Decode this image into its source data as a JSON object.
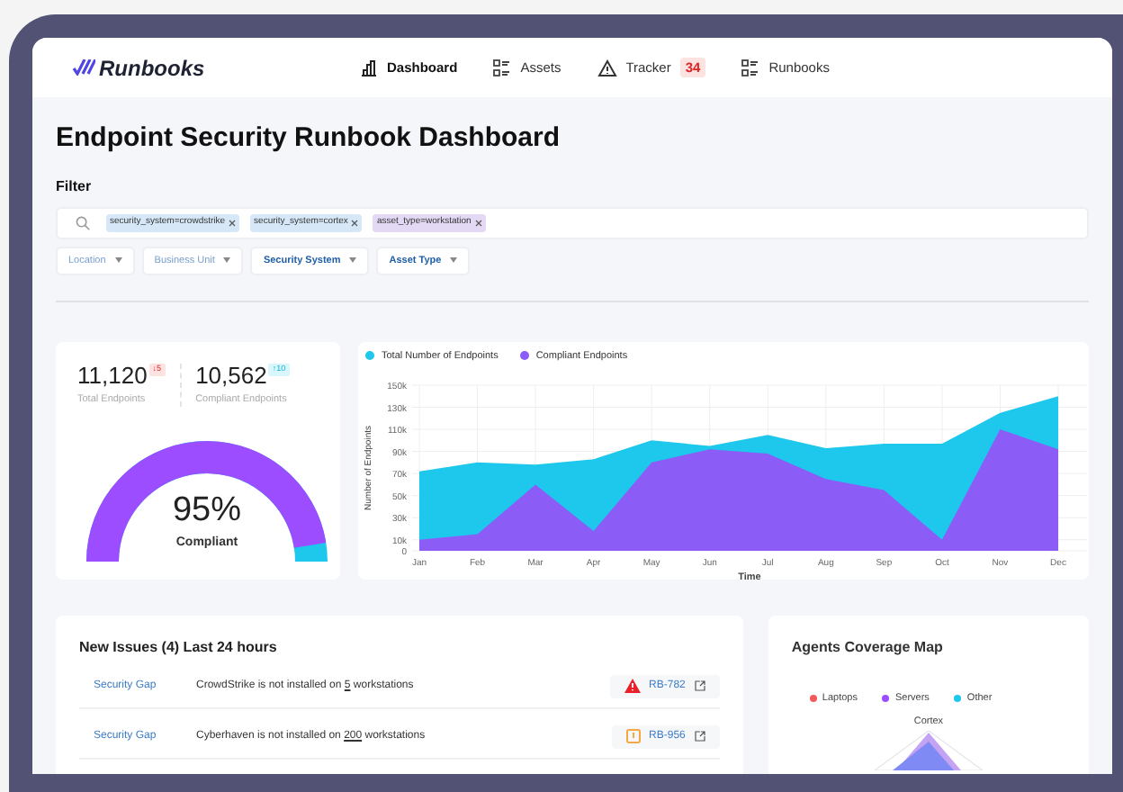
{
  "brand": "Runbooks",
  "nav": [
    {
      "label": "Dashboard",
      "kind": "chart",
      "selected": true
    },
    {
      "label": "Assets",
      "kind": "list",
      "selected": false
    },
    {
      "label": "Tracker",
      "kind": "alert",
      "selected": false,
      "badge": "34"
    },
    {
      "label": "Runbooks",
      "kind": "list",
      "selected": false
    }
  ],
  "title": "Endpoint Security Runbook Dashboard",
  "filter": {
    "label": "Filter",
    "chips": [
      {
        "label": "security_system=crowdstrike",
        "color": "#d6e8f7"
      },
      {
        "label": "security_system=cortex",
        "color": "#d6e8f7"
      },
      {
        "label": "asset_type=workstation",
        "color": "#e3d9f5"
      }
    ],
    "dropdowns": [
      {
        "label": "Location",
        "active": false
      },
      {
        "label": "Business Unit",
        "active": false
      },
      {
        "label": "Security System",
        "active": true
      },
      {
        "label": "Asset Type",
        "active": true
      }
    ]
  },
  "stats": [
    {
      "value": "11,120",
      "delta": "↓5",
      "kind": "down",
      "label": "Total Endpoints"
    },
    {
      "value": "10,562",
      "delta": "↑10",
      "kind": "up",
      "label": "Compliant Endpoints"
    }
  ],
  "gauge": {
    "reading": "95%",
    "label": "Compliant",
    "level": 0.95
  },
  "chart_data": {
    "type": "area",
    "stacked": false,
    "grid": true,
    "legend": "top",
    "xlabel": "Time",
    "ylabel": "Number of Endpoints",
    "categories": [
      "Jan",
      "Feb",
      "Mar",
      "Apr",
      "May",
      "Jun",
      "Jul",
      "Aug",
      "Sep",
      "Oct",
      "Nov",
      "Dec"
    ],
    "ylim": [
      0,
      150000
    ],
    "yticks": [
      {
        "value": 0,
        "label": "0"
      },
      {
        "value": 10000,
        "label": "10k"
      },
      {
        "value": 30000,
        "label": "30k"
      },
      {
        "value": 50000,
        "label": "50k"
      },
      {
        "value": 70000,
        "label": "70k"
      },
      {
        "value": 90000,
        "label": "90k"
      },
      {
        "value": 110000,
        "label": "110k"
      },
      {
        "value": 130000,
        "label": "130k"
      },
      {
        "value": 150000,
        "label": "150k"
      }
    ],
    "series": [
      {
        "name": "Total Number of Endpoints",
        "color": "#1ec8ec",
        "values": [
          72000,
          80000,
          78000,
          83000,
          100000,
          95000,
          105000,
          93000,
          97000,
          97000,
          125000,
          140000
        ]
      },
      {
        "name": "Compliant Endpoints",
        "color": "#8b5cf6",
        "values": [
          10000,
          15000,
          60000,
          18000,
          80000,
          92000,
          88000,
          65000,
          55000,
          10000,
          110000,
          92000
        ]
      }
    ]
  },
  "issues": {
    "title": "New Issues (4) Last 24 hours",
    "rows": [
      {
        "category": "Security Gap",
        "text_before": "CrowdStrike is not installed on",
        "count": "5",
        "text_after": "workstations",
        "kind": "critical",
        "ticket": "RB-782"
      },
      {
        "category": "Security Gap",
        "text_before": "Cyberhaven is not installed on",
        "count": "200",
        "text_after": "workstations",
        "kind": "warning",
        "ticket": "RB-956"
      }
    ]
  },
  "coverage": {
    "title": "Agents Coverage Map",
    "legend": [
      {
        "label": "Laptops",
        "color": "#f25a5a"
      },
      {
        "label": "Servers",
        "color": "#9b4dff"
      },
      {
        "label": "Other",
        "color": "#1ec8ec"
      }
    ],
    "axis_label": "Cortex"
  }
}
